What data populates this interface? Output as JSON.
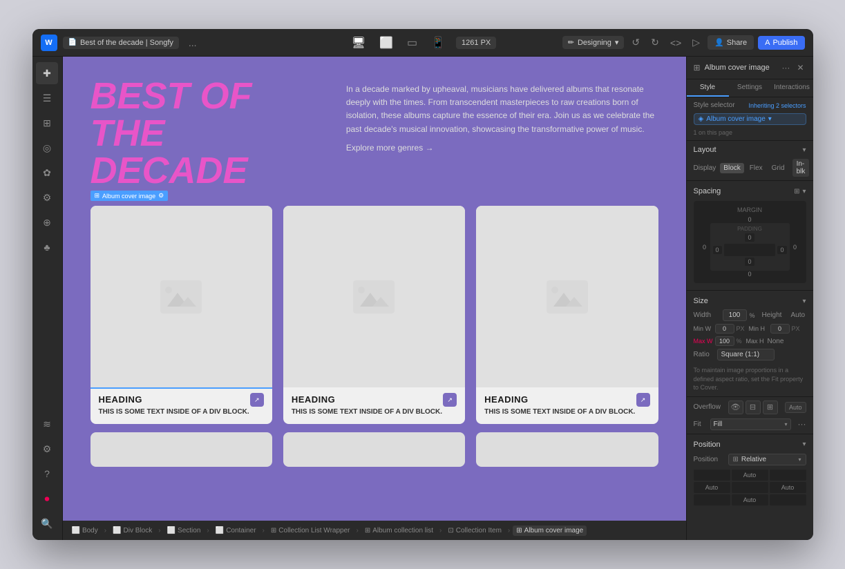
{
  "window": {
    "title": "Best of the decade | Songfy"
  },
  "titlebar": {
    "logo": "W",
    "tab_label": "Best of the decade | Songfy",
    "more_label": "...",
    "device_sizes": [
      "desktop",
      "tablet-landscape",
      "tablet",
      "mobile"
    ],
    "px_label": "1261 PX",
    "mode_label": "Designing",
    "undo_icon": "↺",
    "redo_icon": "↻",
    "code_icon": "<>",
    "play_icon": "▷",
    "a_icon": "A",
    "share_label": "Share",
    "publish_label": "Publish"
  },
  "left_sidebar": {
    "icons": [
      "✚",
      "☰",
      "⊞",
      "◎",
      "✿",
      "⚙",
      "⊕",
      "♣",
      "≋"
    ]
  },
  "canvas": {
    "hero_title_line1": "BEST OF",
    "hero_title_line2": "THE DECADE",
    "description": "In a decade marked by upheaval, musicians have delivered albums that resonate deeply with the times. From transcendent masterpieces to raw creations born of isolation, these albums capture the essence of their era. Join us as we celebrate the past decade's musical innovation, showcasing the transformative power of music.",
    "explore_link": "Explore more genres →",
    "selected_label": "Album cover image",
    "selected_icon": "⚙",
    "cards": [
      {
        "heading": "HEADING",
        "text": "THIS IS SOME TEXT INSIDE OF A DIV BLOCK.",
        "selected": true
      },
      {
        "heading": "HEADING",
        "text": "THIS IS SOME TEXT INSIDE OF A DIV BLOCK.",
        "selected": false
      },
      {
        "heading": "HEADING",
        "text": "THIS IS SOME TEXT INSIDE OF A DIV BLOCK.",
        "selected": false
      }
    ],
    "second_row_cards": [
      true,
      false,
      false
    ]
  },
  "breadcrumb": {
    "items": [
      "Body",
      "Div Block",
      "Section",
      "Container",
      "Collection List Wrapper",
      "Album collection list",
      "Collection Item",
      "Album cover image"
    ]
  },
  "right_panel": {
    "header_title": "Album cover image",
    "header_icon": "⊞",
    "tabs": [
      "Style",
      "Settings",
      "Interactions"
    ],
    "active_tab": "Style",
    "style_selector_label": "Style selector",
    "inheriting_label": "Inheriting 2 selectors",
    "selector_badge": "Album cover image",
    "on_page": "1 on this page",
    "layout": {
      "title": "Layout",
      "display_label": "Display",
      "options": [
        "Block",
        "Flex",
        "Grid"
      ],
      "active_option": "Block",
      "in_blk_label": "In-blk"
    },
    "spacing": {
      "title": "Spacing",
      "margin_label": "MARGIN",
      "margin_top": "0",
      "margin_right": "0",
      "margin_bottom": "0",
      "margin_left": "0",
      "padding_label": "PADDING",
      "padding_top": "0",
      "padding_right": "0",
      "padding_bottom": "0",
      "padding_left": "0"
    },
    "size": {
      "title": "Size",
      "width_label": "Width",
      "width_val": "100",
      "width_unit": "%",
      "height_label": "Height",
      "height_val": "Auto",
      "min_w_label": "Min W",
      "min_w_val": "0",
      "min_w_unit": "PX",
      "min_h_label": "Min H",
      "min_h_val": "0",
      "min_h_unit": "PX",
      "max_w_label": "Max W",
      "max_w_val": "100",
      "max_w_unit": "%",
      "max_h_label": "Max H",
      "max_h_val": "None"
    },
    "ratio": {
      "label": "Ratio",
      "value": "Square (1:1)",
      "note": "To maintain image proportions in a defined aspect ratio, set the Fit property to Cover."
    },
    "overflow": {
      "label": "Overflow",
      "auto_label": "Auto"
    },
    "fit": {
      "label": "Fit",
      "value": "Fill"
    },
    "position": {
      "title": "Position",
      "label": "Position",
      "value": "Relative",
      "offsets": [
        "Auto",
        "",
        "Auto",
        "",
        "Auto",
        "",
        "Auto"
      ]
    }
  }
}
